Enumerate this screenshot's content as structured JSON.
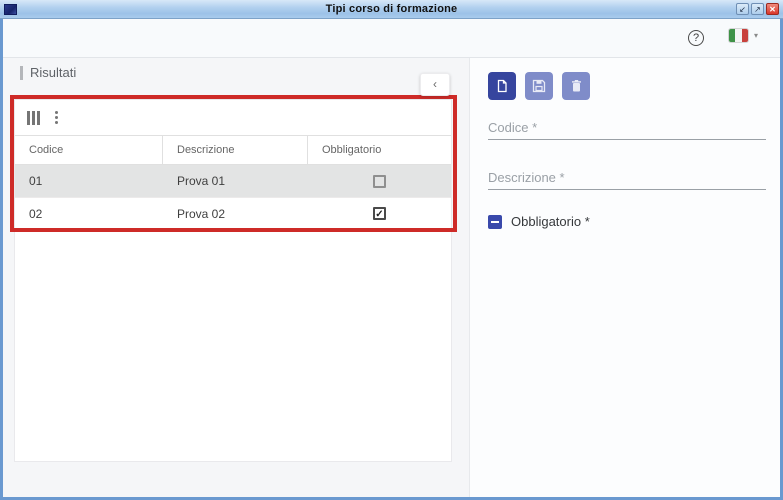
{
  "window": {
    "title": "Tipi corso di formazione",
    "controls": [
      {
        "name": "restore-down",
        "glyph": "↙"
      },
      {
        "name": "maximize",
        "glyph": "↗"
      },
      {
        "name": "close",
        "glyph": "✕"
      }
    ]
  },
  "header": {
    "help_glyph": "?",
    "language": {
      "flag": "italian-flag",
      "arrow_glyph": "▾"
    }
  },
  "results": {
    "title": "Risultati",
    "collapse_glyph": "‹",
    "toolbar_icons": [
      "column-chooser",
      "kebab-menu"
    ],
    "table": {
      "headers": [
        "Codice",
        "Descrizione",
        "Obbligatorio"
      ],
      "rows": [
        {
          "codice": "01",
          "descrizione": "Prova 01",
          "obbligatorio": false,
          "check_glyph": "",
          "selected": true
        },
        {
          "codice": "02",
          "descrizione": "Prova 02",
          "obbligatorio": true,
          "check_glyph": "✓",
          "selected": false
        }
      ]
    }
  },
  "detail": {
    "toolbar_icons": [
      "new-document",
      "save",
      "delete"
    ],
    "codice_label": "Codice *",
    "descrizione_label": "Descrizione *",
    "obbligatorio_label": "Obbligatorio *",
    "obbligatorio_state": "indeterminate"
  },
  "annotation": {
    "shape": "rectangle",
    "color": "#ce2b28"
  },
  "colors": {
    "accent": "#36459e",
    "accent_disabled": "#7f8cc9",
    "titlebar": "#a9cbec",
    "window_border": "#6a99d0",
    "selected_row": "#e3e4e4",
    "flag_green": "#3f9247",
    "flag_red": "#c8413c"
  }
}
